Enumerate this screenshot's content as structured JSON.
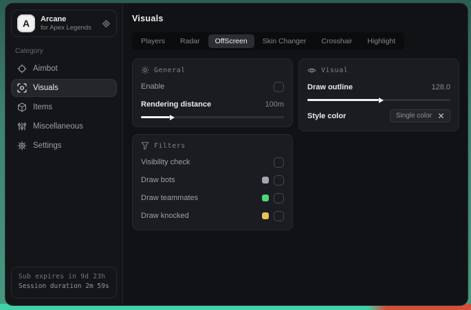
{
  "app": {
    "name": "Arcane",
    "tagline": "for Apex Legends",
    "logo_initial": "A"
  },
  "sidebar": {
    "category_label": "Category",
    "items": [
      {
        "label": "Aimbot",
        "icon": "crosshair-icon",
        "active": false
      },
      {
        "label": "Visuals",
        "icon": "scan-eye-icon",
        "active": true
      },
      {
        "label": "Items",
        "icon": "cube-icon",
        "active": false
      },
      {
        "label": "Miscellaneous",
        "icon": "sliders-icon",
        "active": false
      },
      {
        "label": "Settings",
        "icon": "gear-icon",
        "active": false
      }
    ],
    "footer": {
      "sub_expires": "Sub expires in 9d 23h",
      "session_duration": "Session duration 2m 59s"
    }
  },
  "main": {
    "title": "Visuals",
    "tabs": [
      {
        "label": "Players",
        "active": false
      },
      {
        "label": "Radar",
        "active": false
      },
      {
        "label": "OffScreen",
        "active": true
      },
      {
        "label": "Skin Changer",
        "active": false
      },
      {
        "label": "Crosshair",
        "active": false
      },
      {
        "label": "Highlight",
        "active": false
      }
    ],
    "general_card": {
      "title": "General",
      "enable_label": "Enable",
      "enable_checked": false,
      "rendering_distance_label": "Rendering distance",
      "rendering_distance_value": "100m",
      "rendering_distance_percent": 20
    },
    "visual_card": {
      "title": "Visual",
      "draw_outline_label": "Draw outline",
      "draw_outline_value": "128.0",
      "draw_outline_percent": 50,
      "style_color_label": "Style color",
      "style_color_value": "Single color"
    },
    "filters_card": {
      "title": "Filters",
      "rows": [
        {
          "label": "Visibility check",
          "swatch": null,
          "checked": false
        },
        {
          "label": "Draw bots",
          "swatch": "#a3a7ad",
          "checked": false
        },
        {
          "label": "Draw teammates",
          "swatch": "#4cd776",
          "checked": false
        },
        {
          "label": "Draw knocked",
          "swatch": "#e3c455",
          "checked": false
        }
      ]
    }
  },
  "colors": {
    "accent_mint": "#40d1a9",
    "accent_red": "#d2503a",
    "slider_fill": "#f1f2f3"
  }
}
